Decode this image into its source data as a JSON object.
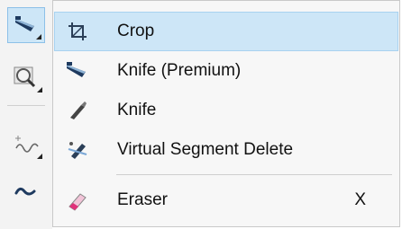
{
  "toolbox": {
    "tools": [
      {
        "name": "knife-tool-icon",
        "active": true
      },
      {
        "name": "zoom-tool-icon",
        "active": false
      },
      {
        "name": "freehand-tool-icon",
        "active": false
      },
      {
        "name": "smart-drawing-tool-icon",
        "active": false
      }
    ]
  },
  "menu": {
    "items": [
      {
        "label": "Crop",
        "icon": "crop-icon",
        "shortcut": ""
      },
      {
        "label": "Knife (Premium)",
        "icon": "knife-premium-icon",
        "shortcut": ""
      },
      {
        "label": "Knife",
        "icon": "knife-icon",
        "shortcut": ""
      },
      {
        "label": "Virtual Segment Delete",
        "icon": "virtual-segment-delete-icon",
        "shortcut": ""
      },
      {
        "label": "Eraser",
        "icon": "eraser-icon",
        "shortcut": "X"
      }
    ]
  },
  "colors": {
    "highlight": "#cde6f7",
    "menu_background": "#f7f7f7",
    "toolbox_background": "#f3f3f3"
  }
}
